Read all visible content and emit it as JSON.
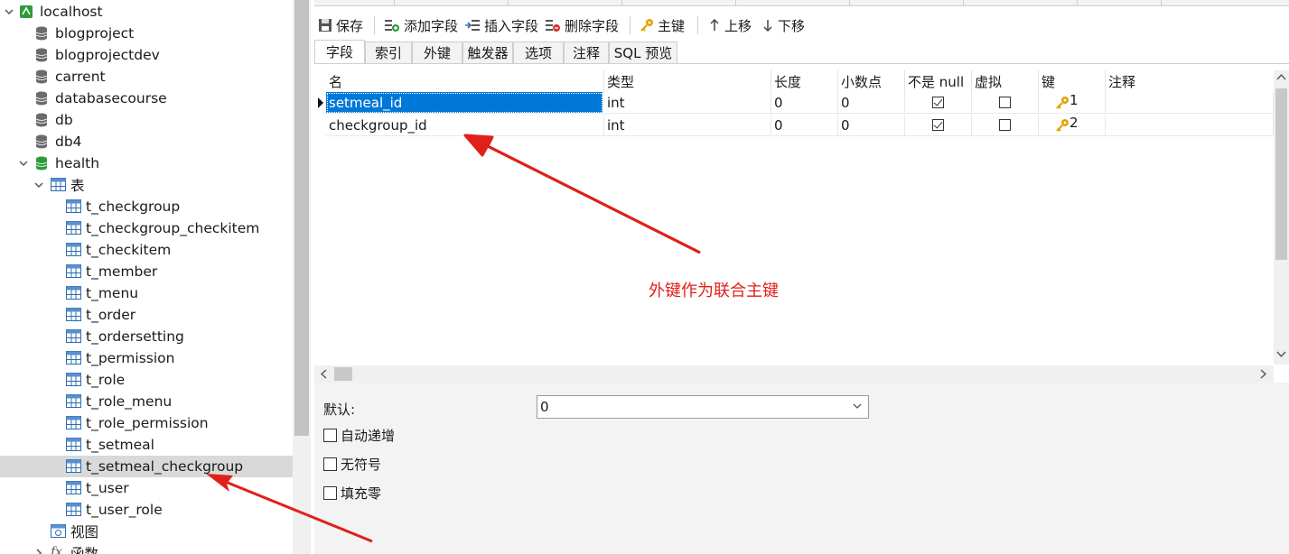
{
  "sidebar": {
    "connection": "localhost",
    "databases": [
      "blogproject",
      "blogprojectdev",
      "carrent",
      "databasecourse",
      "db",
      "db4"
    ],
    "open_database": "health",
    "tables_group": "表",
    "tables": [
      "t_checkgroup",
      "t_checkgroup_checkitem",
      "t_checkitem",
      "t_member",
      "t_menu",
      "t_order",
      "t_ordersetting",
      "t_permission",
      "t_role",
      "t_role_menu",
      "t_role_permission",
      "t_setmeal",
      "t_setmeal_checkgroup",
      "t_user",
      "t_user_role"
    ],
    "selected_table": "t_setmeal_checkgroup",
    "views_group": "视图",
    "functions_group": "函数"
  },
  "toolbar": {
    "save": "保存",
    "add_field": "添加字段",
    "insert_field": "插入字段",
    "delete_field": "删除字段",
    "primary_key": "主键",
    "move_up": "上移",
    "move_down": "下移"
  },
  "tabs": [
    "字段",
    "索引",
    "外键",
    "触发器",
    "选项",
    "注释",
    "SQL 预览"
  ],
  "active_tab": "字段",
  "grid": {
    "columns": [
      "名",
      "类型",
      "长度",
      "小数点",
      "不是 null",
      "虚拟",
      "键",
      "注释"
    ],
    "rows": [
      {
        "name": "setmeal_id",
        "type": "int",
        "length": "0",
        "decimals": "0",
        "not_null": true,
        "virtual": false,
        "key": "1",
        "comment": ""
      },
      {
        "name": "checkgroup_id",
        "type": "int",
        "length": "0",
        "decimals": "0",
        "not_null": true,
        "virtual": false,
        "key": "2",
        "comment": ""
      }
    ]
  },
  "annotation": "外键作为联合主键",
  "properties": {
    "default_label": "默认:",
    "default_value": "0",
    "auto_increment": "自动递增",
    "unsigned": "无符号",
    "zerofill": "填充零"
  },
  "colors": {
    "selection": "#0078d7",
    "annotation_red": "#e0201a",
    "db_open_green": "#2e9b3a",
    "db_gray": "#6b6b6b",
    "key_gold": "#e0a400"
  }
}
